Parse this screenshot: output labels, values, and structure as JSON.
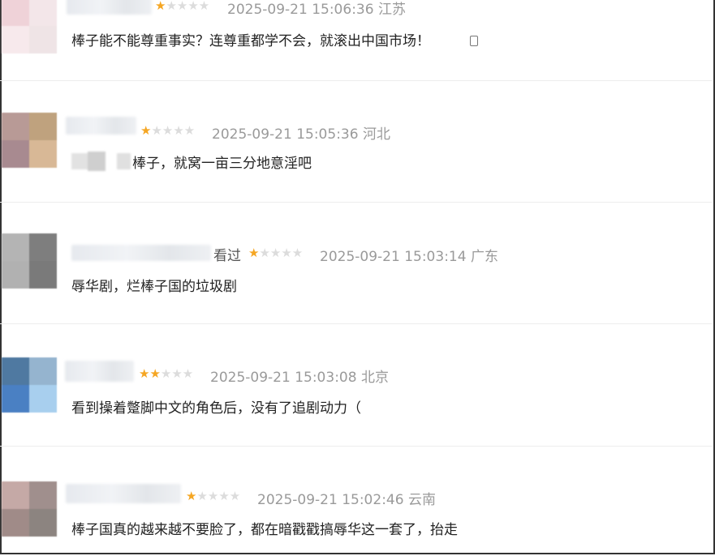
{
  "comments": [
    {
      "stars": [
        "on",
        "off",
        "off",
        "off",
        "off"
      ],
      "datetime": "2025-09-21 15:06:36",
      "location": "江苏",
      "text": "棒子能不能尊重事实？连尊重都学不会，就滚出中国市场！",
      "avatar_colors": [
        "#efd2d8",
        "#f3e6e9",
        "#f7e9ec",
        "#efe4e6"
      ]
    },
    {
      "stars": [
        "on",
        "off",
        "off",
        "off",
        "off"
      ],
      "datetime": "2025-09-21 15:05:36",
      "location": "河北",
      "text": "棒子，就窝一亩三分地意淫吧",
      "avatar_colors": [
        "#b89a96",
        "#bfa27e",
        "#a88a90",
        "#d8b896"
      ]
    },
    {
      "seen_label": "看过",
      "stars": [
        "on",
        "off",
        "off",
        "off",
        "off"
      ],
      "datetime": "2025-09-21 15:03:14",
      "location": "广东",
      "text": "辱华剧，烂棒子国的垃圾剧",
      "avatar_colors": [
        "#b4b4b4",
        "#7e7e7e",
        "#b1b1b1",
        "#7a7a7a"
      ]
    },
    {
      "stars": [
        "on",
        "on",
        "off",
        "off",
        "off"
      ],
      "datetime": "2025-09-21 15:03:08",
      "location": "北京",
      "text": "看到操着蹩脚中文的角色后，没有了追剧动力（",
      "avatar_colors": [
        "#4f79a1",
        "#95b4cf",
        "#4a80c3",
        "#a8cfee"
      ]
    },
    {
      "stars": [
        "on",
        "off",
        "off",
        "off",
        "off"
      ],
      "datetime": "2025-09-21 15:02:46",
      "location": "云南",
      "text": "棒子国真的越来越不要脸了，都在暗戳戳搞辱华这一套了，抬走",
      "avatar_colors": [
        "#c5a9a6",
        "#a08f8d",
        "#a08b88",
        "#8c8480"
      ]
    }
  ]
}
